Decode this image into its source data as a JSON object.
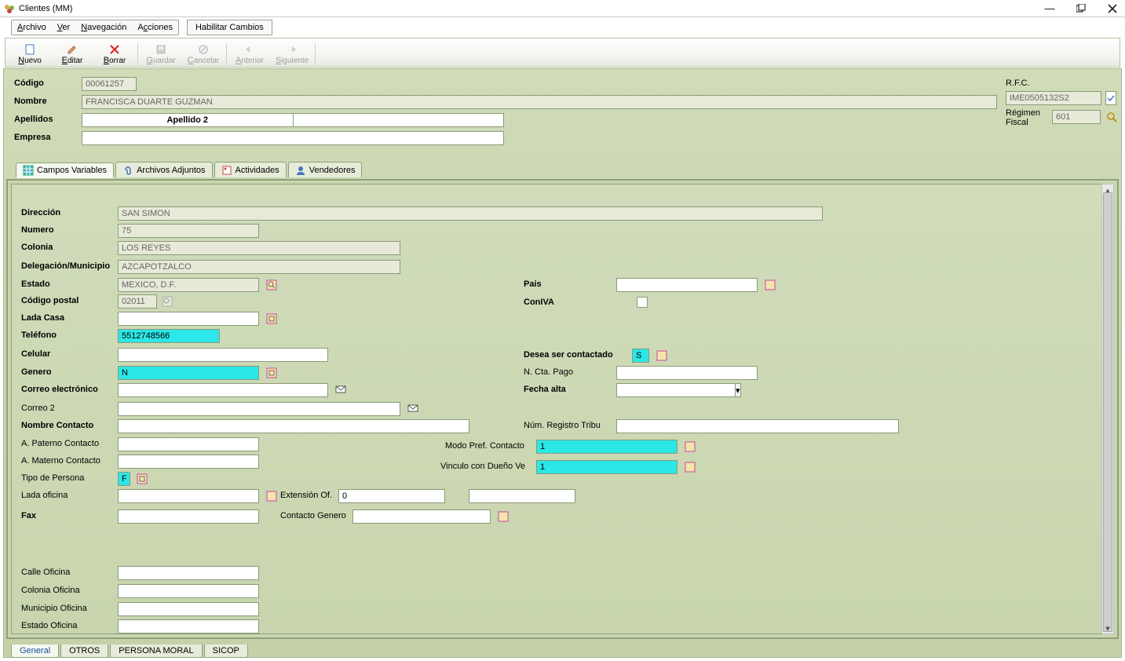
{
  "window": {
    "title": "Clientes (MM)"
  },
  "menu": {
    "archivo": "Archivo",
    "ver": "Ver",
    "navegacion": "Navegación",
    "acciones": "Acciones",
    "habilitar": "Habilitar Cambios"
  },
  "toolbar": {
    "nuevo": "Nuevo",
    "editar": "Editar",
    "borrar": "Borrar",
    "guardar": "Guardar",
    "cancelar": "Cancelar",
    "anterior": "Anterior",
    "siguiente": "Siguiente"
  },
  "header": {
    "codigo_label": "Código",
    "codigo": "00061257",
    "nombre_label": "Nombre",
    "nombre": "FRANCISCA DUARTE GUZMAN",
    "apellidos_label": "Apellidos",
    "apellido2_header": "Apellido 2",
    "empresa_label": "Empresa",
    "empresa": "",
    "rfc_label": "R.F.C.",
    "rfc": "IME0505132S2",
    "regimen_label1": "Régimen",
    "regimen_label2": "Fiscal",
    "regimen": "601"
  },
  "tabs_top": {
    "campos": "Campos Variables",
    "archivos": "Archivos Adjuntos",
    "actividades": "Actividades",
    "vendedores": "Vendedores"
  },
  "form": {
    "direccion_label": "Dirección",
    "direccion": "SAN SIMON",
    "numero_label": "Numero",
    "numero": "75",
    "colonia_label": "Colonia",
    "colonia": "LOS REYES",
    "delegacion_label": "Delegación/Municipio",
    "delegacion": "AZCAPOTZALCO",
    "estado_label": "Estado",
    "estado": "MEXICO, D.F.",
    "cp_label": "Código postal",
    "cp": "02011",
    "ladacasa_label": "Lada Casa",
    "ladacasa": "",
    "telefono_label": "Teléfono",
    "telefono": "5512748566",
    "celular_label": "Celular",
    "celular": "",
    "genero_label": "Genero",
    "genero": "N",
    "correo_label": "Correo electrónico",
    "correo": "",
    "correo2_label": "Correo 2",
    "correo2": "",
    "nombrecontacto_label": "Nombre Contacto",
    "nombrecontacto": "",
    "apaterno_label": "A. Paterno Contacto",
    "apaterno": "",
    "amaterno_label": "A. Materno Contacto",
    "amaterno": "",
    "tipopersona_label": "Tipo de Persona",
    "tipopersona": "F",
    "ladaoficina_label": "Lada oficina",
    "ladaoficina": "",
    "extension_label": "Extensión Of.",
    "extension": "0",
    "fax_label": "Fax",
    "fax": "",
    "contactogenero_label": "Contacto Genero",
    "contactogenero": "",
    "calleoficina_label": "Calle Oficina",
    "calleoficina": "",
    "coloniaoficina_label": "Colonia Oficina",
    "coloniaoficina": "",
    "municipiooficina_label": "Municipio Oficina",
    "municipiooficina": "",
    "estadooficina_label": "Estado Oficina",
    "estadooficina": "",
    "pais_label": "Pais",
    "pais": "",
    "coniva_label": "ConIVA",
    "deseacontacto_label": "Desea ser contactado",
    "deseacontacto": "S",
    "nctapago_label": "N. Cta. Pago",
    "nctapago": "",
    "fechaalta_label": "Fecha alta",
    "fechaalta": "",
    "numregistro_label": "Núm. Registro Tribu",
    "numregistro": "",
    "modopref_label": "Modo Pref. Contacto",
    "modopref": "1",
    "vinculo_label": "Vinculo con Dueño Ve",
    "vinculo": "1"
  },
  "tabs_bottom": {
    "general": "General",
    "otros": "OTROS",
    "persona": "PERSONA MORAL",
    "sicop": "SICOP"
  }
}
